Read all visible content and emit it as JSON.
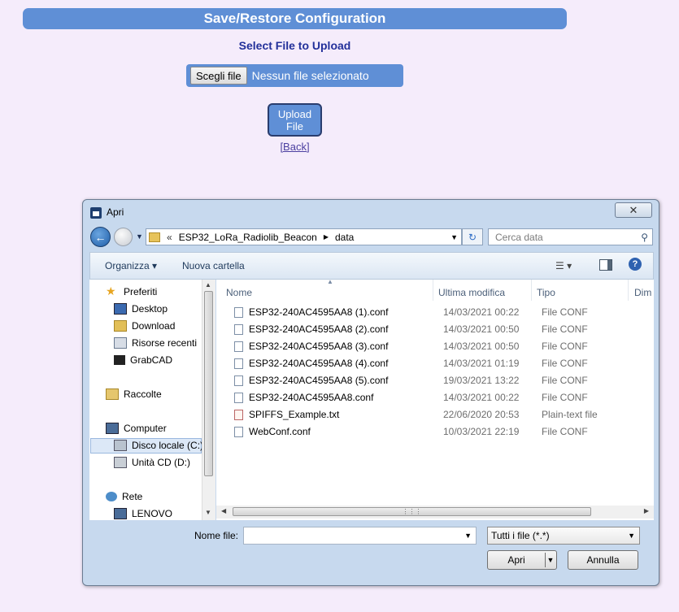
{
  "page": {
    "title": "Save/Restore Configuration",
    "subtitle": "Select File to Upload",
    "choose_file_label": "Scegli file",
    "no_file_text": "Nessun file selezionato",
    "upload_label_line1": "Upload",
    "upload_label_line2": "File",
    "back_link": "[Back]"
  },
  "dialog": {
    "title": "Apri",
    "close_glyph": "✕",
    "address": {
      "chevron": "«",
      "parts": [
        "ESP32_LoRa_Radiolib_Beacon",
        "data"
      ]
    },
    "search_placeholder": "Cerca data",
    "toolbar": {
      "organize": "Organizza",
      "new_folder": "Nuova cartella"
    },
    "nav": {
      "favorites": "Preferiti",
      "desktop": "Desktop",
      "download": "Download",
      "recent": "Risorse recenti",
      "grabcad": "GrabCAD",
      "libraries": "Raccolte",
      "computer": "Computer",
      "local_disk": "Disco locale (C:)",
      "cd_drive": "Unità CD (D:)",
      "network": "Rete",
      "lenovo": "LENOVO"
    },
    "columns": {
      "name": "Nome",
      "modified": "Ultima modifica",
      "type": "Tipo",
      "dim": "Dim"
    },
    "files": [
      {
        "name": "ESP32-240AC4595AA8 (1).conf",
        "date": "14/03/2021 00:22",
        "type": "File CONF",
        "icon": "conf"
      },
      {
        "name": "ESP32-240AC4595AA8 (2).conf",
        "date": "14/03/2021 00:50",
        "type": "File CONF",
        "icon": "conf"
      },
      {
        "name": "ESP32-240AC4595AA8 (3).conf",
        "date": "14/03/2021 00:50",
        "type": "File CONF",
        "icon": "conf"
      },
      {
        "name": "ESP32-240AC4595AA8 (4).conf",
        "date": "14/03/2021 01:19",
        "type": "File CONF",
        "icon": "conf"
      },
      {
        "name": "ESP32-240AC4595AA8 (5).conf",
        "date": "19/03/2021 13:22",
        "type": "File CONF",
        "icon": "conf"
      },
      {
        "name": "ESP32-240AC4595AA8.conf",
        "date": "14/03/2021 00:22",
        "type": "File CONF",
        "icon": "conf"
      },
      {
        "name": "SPIFFS_Example.txt",
        "date": "22/06/2020 20:53",
        "type": "Plain-text file",
        "icon": "txt"
      },
      {
        "name": "WebConf.conf",
        "date": "10/03/2021 22:19",
        "type": "File CONF",
        "icon": "conf"
      }
    ],
    "filename_label": "Nome file:",
    "filename_value": "",
    "filter": "Tutti i file (*.*)",
    "open": "Apri",
    "cancel": "Annulla"
  },
  "colors": {
    "accent": "#5f8fd6",
    "page_bg": "#f5ecfb",
    "subtitle": "#22309a"
  }
}
